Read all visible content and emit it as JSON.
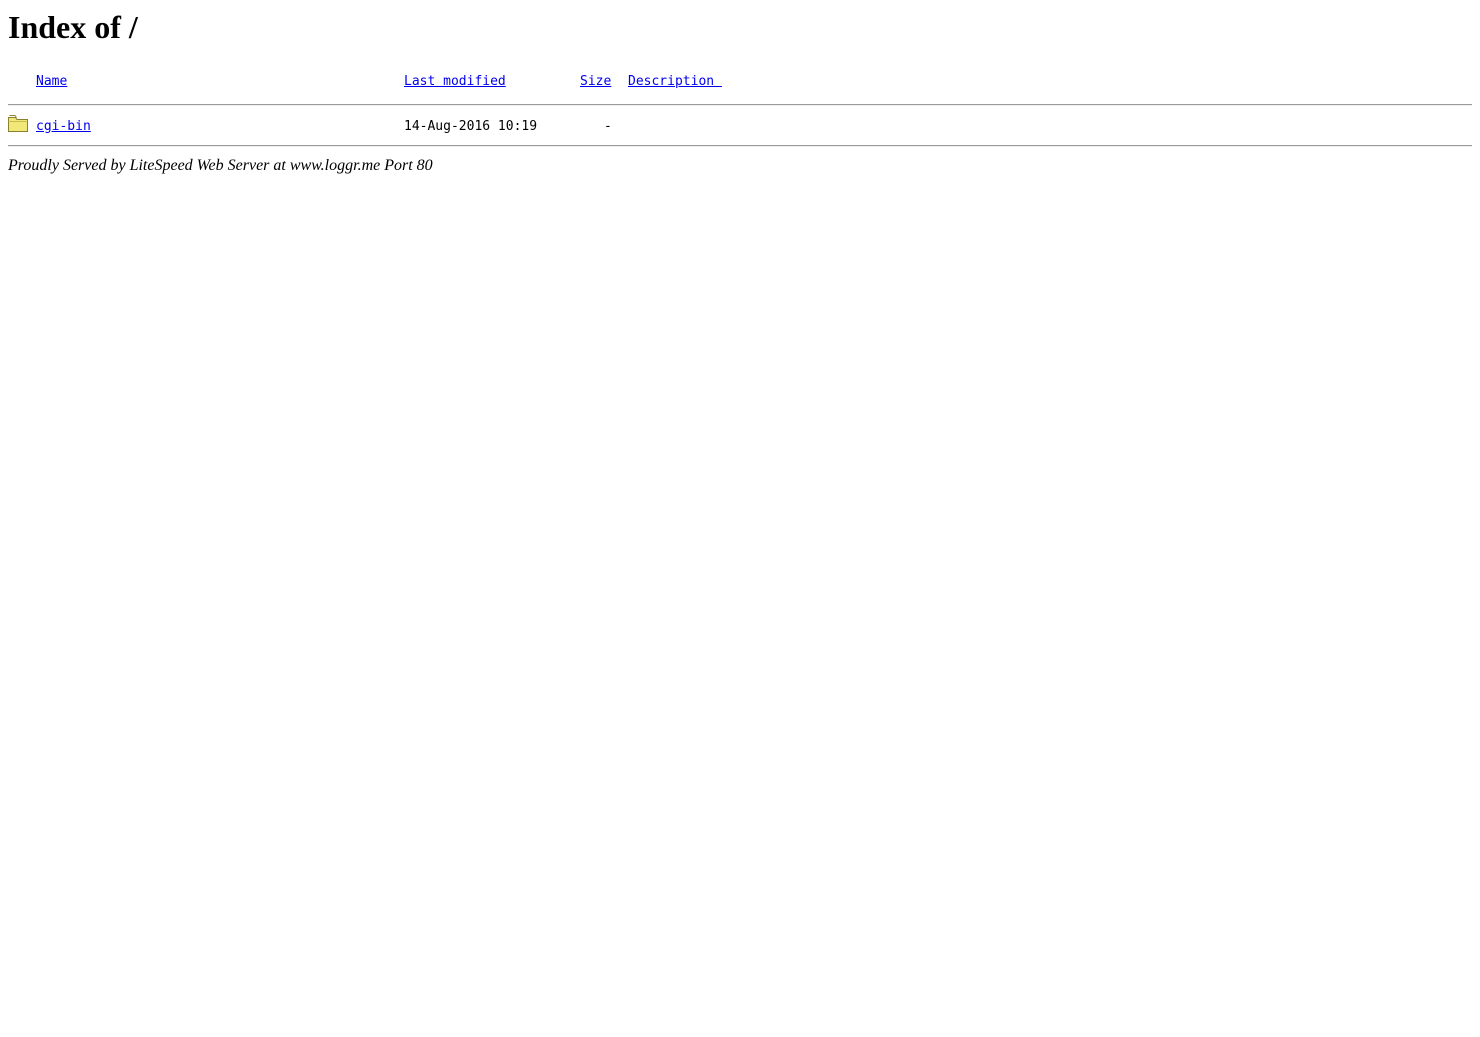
{
  "page": {
    "title": "Index of /"
  },
  "columns": {
    "name": "Name",
    "last_modified": "Last modified",
    "size": "Size",
    "description": "Description "
  },
  "entries": [
    {
      "icon": "folder-icon",
      "name": "cgi-bin",
      "last_modified": "14-Aug-2016 10:19",
      "size": "-",
      "description": ""
    }
  ],
  "footer": {
    "text": "Proudly Served by LiteSpeed Web Server at www.loggr.me Port 80"
  },
  "colors": {
    "link": "#0000ee",
    "folder_fill": "#f2e87a",
    "folder_stroke": "#8a8030"
  }
}
